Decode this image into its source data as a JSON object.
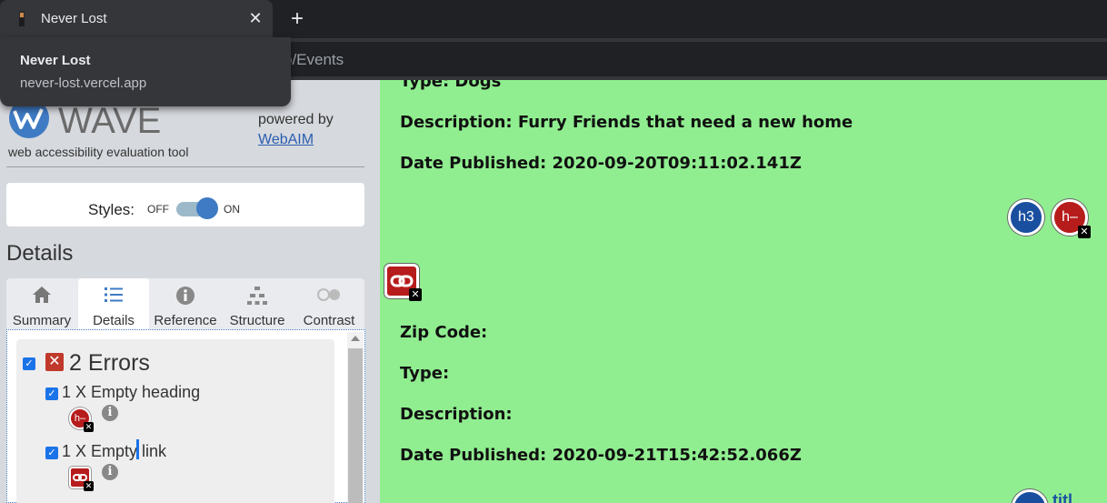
{
  "browser": {
    "tab_title": "Never Lost",
    "close_glyph": "✕",
    "new_tab_glyph": "+",
    "url_partial": "o/Events",
    "tooltip_title": "Never Lost",
    "tooltip_url": "never-lost.vercel.app"
  },
  "wave": {
    "logo_text": "WAVE",
    "subtitle": "web accessibility evaluation tool",
    "powered_by": "powered by",
    "webaim_link": "WebAIM",
    "styles_label": "Styles:",
    "off_label": "OFF",
    "on_label": "ON",
    "styles_on": true,
    "details_heading": "Details",
    "tabs": [
      {
        "label": "Summary",
        "icon": "home-icon"
      },
      {
        "label": "Details",
        "icon": "list-icon"
      },
      {
        "label": "Reference",
        "icon": "info-icon"
      },
      {
        "label": "Structure",
        "icon": "structure-icon"
      },
      {
        "label": "Contrast",
        "icon": "contrast-icon"
      }
    ],
    "active_tab": "Details",
    "errors": {
      "title": "2 Errors",
      "items": [
        {
          "label": "1 X Empty heading",
          "icon_text": "h–"
        },
        {
          "label": "1 X Empty link",
          "icon_text": "link"
        }
      ]
    }
  },
  "content": {
    "lines": [
      "Type: Dogs",
      "Description: Furry Friends that need a new home",
      "Date Published: 2020-09-20T09:11:02.141Z",
      "Zip Code:",
      "Type:",
      "Description:",
      "Date Published: 2020-09-21T15:42:52.066Z"
    ],
    "badges": {
      "h3": "h3",
      "empty_heading": "h–"
    },
    "bottom_partial": "titl"
  },
  "colors": {
    "content_bg": "#90ee90",
    "sidebar_bg": "#d6d9de",
    "error_red": "#b71c1c",
    "heading_blue": "#1a4fa0"
  }
}
